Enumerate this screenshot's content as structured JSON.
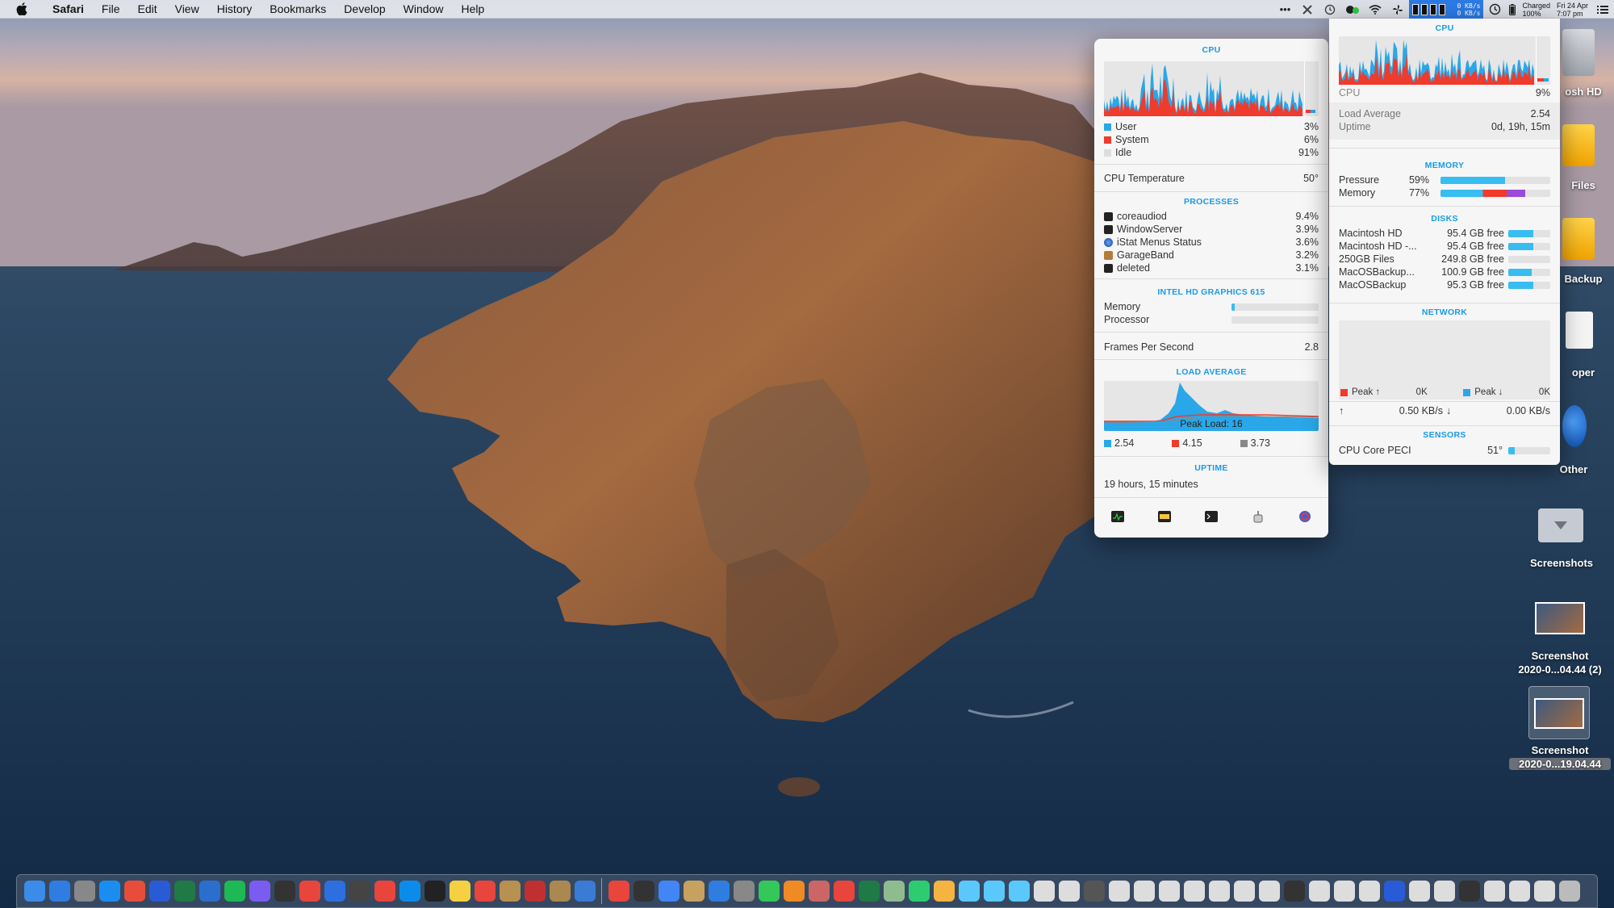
{
  "menubar": {
    "app_name": "Safari",
    "menus": [
      "File",
      "Edit",
      "View",
      "History",
      "Bookmarks",
      "Develop",
      "Window",
      "Help"
    ],
    "network_up": "0 KB/s",
    "network_down": "0 KB/s",
    "battery_status": "Charged",
    "battery_percent": "100%",
    "date": "Fri 24 Apr",
    "time": "7:07 pm"
  },
  "left_panel": {
    "cpu": {
      "title": "CPU",
      "rows": [
        {
          "label": "User",
          "value": "3%",
          "color": "#2aa7e8"
        },
        {
          "label": "System",
          "value": "6%",
          "color": "#f03a2c"
        },
        {
          "label": "Idle",
          "value": "91%",
          "color": "#dddddd"
        }
      ],
      "temperature_label": "CPU Temperature",
      "temperature_value": "50°"
    },
    "processes": {
      "title": "PROCESSES",
      "items": [
        {
          "name": "coreaudiod",
          "value": "9.4%",
          "icon": "terminal-icon"
        },
        {
          "name": "WindowServer",
          "value": "3.9%",
          "icon": "terminal-icon"
        },
        {
          "name": "iStat Menus Status",
          "value": "3.6%",
          "icon": "istat-icon"
        },
        {
          "name": "GarageBand",
          "value": "3.2%",
          "icon": "guitar-icon"
        },
        {
          "name": "deleted",
          "value": "3.1%",
          "icon": "terminal-icon"
        }
      ]
    },
    "gpu": {
      "title": "INTEL HD GRAPHICS 615",
      "rows": [
        {
          "label": "Memory",
          "level": 0.04
        },
        {
          "label": "Processor",
          "level": 0.0
        }
      ],
      "fps_label": "Frames Per Second",
      "fps_value": "2.8"
    },
    "load_average": {
      "title": "LOAD AVERAGE",
      "peak_label": "Peak Load: 16",
      "values": [
        {
          "value": "2.54",
          "color": "#2aa7e8"
        },
        {
          "value": "4.15",
          "color": "#f03a2c"
        },
        {
          "value": "3.73",
          "color": "#888888"
        }
      ]
    },
    "uptime": {
      "title": "UPTIME",
      "value": "19 hours, 15 minutes"
    },
    "toolbar": [
      "activity-monitor-icon",
      "system-info-icon",
      "terminal-icon",
      "console-icon",
      "istat-settings-icon"
    ]
  },
  "right_panel": {
    "cpu": {
      "title": "CPU",
      "label": "CPU",
      "value": "9%",
      "load_label": "Load Average",
      "load_value": "2.54",
      "uptime_label": "Uptime",
      "uptime_value": "0d, 19h, 15m"
    },
    "memory": {
      "title": "MEMORY",
      "rows": [
        {
          "label": "Pressure",
          "value": "59%",
          "level": 0.59
        },
        {
          "label": "Memory",
          "value": "77%",
          "level": 0.77
        }
      ]
    },
    "disks": {
      "title": "DISKS",
      "items": [
        {
          "name": "Macintosh HD",
          "free": "95.4 GB free",
          "level": 0.6
        },
        {
          "name": "Macintosh HD -...",
          "free": "95.4 GB free",
          "level": 0.6
        },
        {
          "name": "250GB Files",
          "free": "249.8 GB free",
          "level": 0.0
        },
        {
          "name": "MacOSBackup...",
          "free": "100.9 GB free",
          "level": 0.55
        },
        {
          "name": "MacOSBackup",
          "free": "95.3 GB free",
          "level": 0.6
        }
      ]
    },
    "network": {
      "title": "NETWORK",
      "peak_up_label": "Peak ↑",
      "peak_up_value": "0K",
      "peak_down_label": "Peak ↓",
      "peak_down_value": "0K",
      "up_rate": "0.50 KB/s",
      "down_rate": "0.00 KB/s"
    },
    "sensors": {
      "title": "SENSORS",
      "label": "CPU Core PECI",
      "value": "51°",
      "level": 0.15
    }
  },
  "desktop": {
    "icons": [
      {
        "label": "osh HD"
      },
      {
        "label": "Files"
      },
      {
        "label": "Backup"
      },
      {
        "label": "oper"
      },
      {
        "label": "Other"
      },
      {
        "label": "Screenshots"
      },
      {
        "label": "Screenshot\n2020-0...04.44 (2)"
      },
      {
        "label": "Screenshot"
      },
      {
        "label": "2020-0...19.04.44"
      }
    ]
  },
  "colors": {
    "accent": "#1a9be6",
    "user": "#2aa7e8",
    "system": "#f03a2c",
    "bar": "#38bdf0"
  }
}
